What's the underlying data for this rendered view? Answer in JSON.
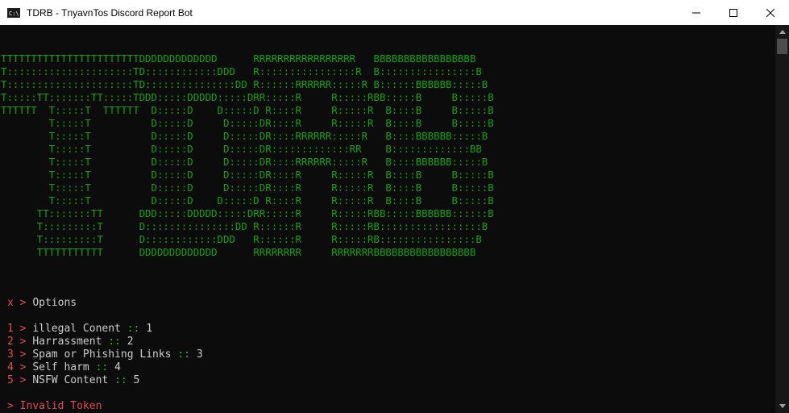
{
  "window": {
    "title": "TDRB - TnyavnTos Discord Report Bot",
    "icon_label": "C:\\."
  },
  "banner": [
    "TTTTTTTTTTTTTTTTTTTTTTTDDDDDDDDDDDDD      RRRRRRRRRRRRRRRRR   BBBBBBBBBBBBBBBBB",
    "T:::::::::::::::::::::TD::::::::::::DDD   R::::::::::::::::R  B::::::::::::::::B",
    "T:::::::::::::::::::::TD:::::::::::::::DD R::::::RRRRRR:::::R B::::::BBBBBB:::::B",
    "T:::::TT:::::::TT:::::TDDD:::::DDDDD:::::DRR:::::R     R:::::RBB:::::B     B:::::B",
    "TTTTTT  T:::::T  TTTTTT  D:::::D    D:::::D R::::R     R:::::R  B::::B     B:::::B",
    "        T:::::T          D:::::D     D:::::DR::::R     R:::::R  B::::B     B:::::B",
    "        T:::::T          D:::::D     D:::::DR::::RRRRRR:::::R   B::::BBBBBB:::::B",
    "        T:::::T          D:::::D     D:::::DR:::::::::::::RR    B:::::::::::::BB",
    "        T:::::T          D:::::D     D:::::DR::::RRRRRR:::::R   B::::BBBBBB:::::B",
    "        T:::::T          D:::::D     D:::::DR::::R     R:::::R  B::::B     B:::::B",
    "        T:::::T          D:::::D     D:::::DR::::R     R:::::R  B::::B     B:::::B",
    "        T:::::T          D:::::D    D:::::D R::::R     R:::::R  B::::B     B:::::B",
    "      TT:::::::TT      DDD:::::DDDDD:::::DRR:::::R     R:::::RBB:::::BBBBBB::::::B",
    "      T:::::::::T      D:::::::::::::::DD R::::::R     R:::::RB:::::::::::::::::B",
    "      T:::::::::T      D::::::::::::DDD   R::::::R     R:::::RB::::::::::::::::B",
    "      TTTTTTTTTTT      DDDDDDDDDDDDD      RRRRRRRR     RRRRRRRBBBBBBBBBBBBBBBBB"
  ],
  "options_header": {
    "key": "x",
    "arrow": ">",
    "label": "Options"
  },
  "options": [
    {
      "num": "1",
      "arrow": ">",
      "label": "illegal Conent",
      "sep": "::",
      "value": "1"
    },
    {
      "num": "2",
      "arrow": ">",
      "label": "Harrassment",
      "sep": "::",
      "value": "2"
    },
    {
      "num": "3",
      "arrow": ">",
      "label": "Spam or Phishing Links",
      "sep": "::",
      "value": "3"
    },
    {
      "num": "4",
      "arrow": ">",
      "label": "Self harm",
      "sep": "::",
      "value": "4"
    },
    {
      "num": "5",
      "arrow": ">",
      "label": "NSFW Content",
      "sep": "::",
      "value": "5"
    }
  ],
  "status": {
    "arrow": ">",
    "message": "Invalid Token"
  },
  "colors": {
    "banner": "#13a10e",
    "red": "#e74856",
    "green": "#16c60c",
    "text": "#cccccc",
    "background": "#0c0c0c"
  }
}
